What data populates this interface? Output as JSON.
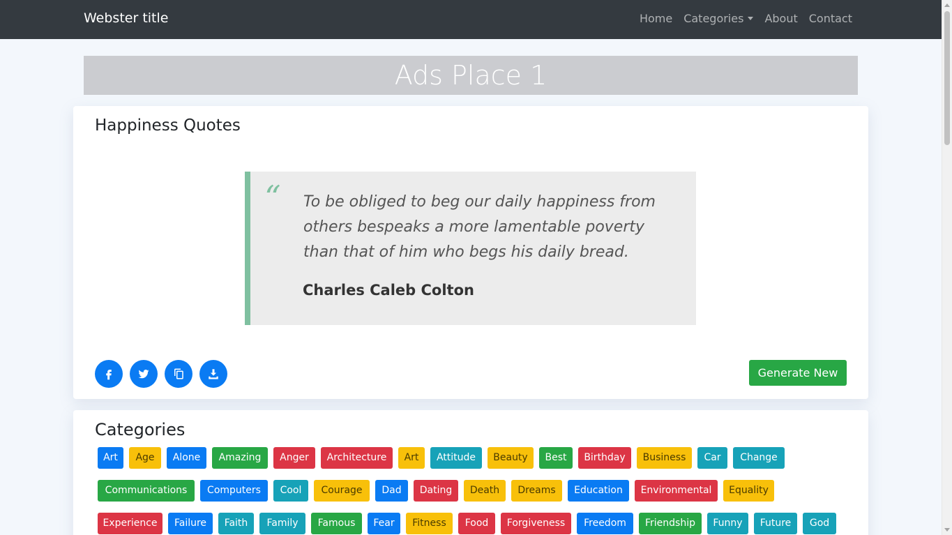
{
  "navbar": {
    "brand": "Webster title",
    "links": [
      "Home",
      "Categories",
      "About",
      "Contact"
    ]
  },
  "ads": {
    "label": "Ads Place 1"
  },
  "quote_card": {
    "title": "Happiness Quotes",
    "quote_mark": "“",
    "quote": "To be obliged to beg our daily happiness from others bespeaks a more lamentable poverty than that of him who begs his daily bread.",
    "author": "Charles Caleb Colton",
    "share_icons": [
      "facebook-icon",
      "twitter-icon",
      "copy-icon",
      "download-icon"
    ],
    "generate_label": "Generate New"
  },
  "categories": {
    "title": "Categories",
    "rows": [
      [
        {
          "label": "Art",
          "color": "primary"
        },
        {
          "label": "Age",
          "color": "warning"
        },
        {
          "label": "Alone",
          "color": "primary"
        },
        {
          "label": "Amazing",
          "color": "success"
        },
        {
          "label": "Anger",
          "color": "danger"
        },
        {
          "label": "Architecture",
          "color": "danger"
        },
        {
          "label": "Art",
          "color": "warning"
        },
        {
          "label": "Attitude",
          "color": "info"
        },
        {
          "label": "Beauty",
          "color": "warning"
        },
        {
          "label": "Best",
          "color": "success"
        },
        {
          "label": "Birthday",
          "color": "danger"
        },
        {
          "label": "Business",
          "color": "warning"
        },
        {
          "label": "Car",
          "color": "info"
        },
        {
          "label": "Change",
          "color": "info"
        }
      ],
      [
        {
          "label": "Communications",
          "color": "success"
        },
        {
          "label": "Computers",
          "color": "primary"
        },
        {
          "label": "Cool",
          "color": "info"
        },
        {
          "label": "Courage",
          "color": "warning"
        },
        {
          "label": "Dad",
          "color": "primary"
        },
        {
          "label": "Dating",
          "color": "danger"
        },
        {
          "label": "Death",
          "color": "warning"
        },
        {
          "label": "Dreams",
          "color": "warning"
        },
        {
          "label": "Education",
          "color": "primary"
        },
        {
          "label": "Environmental",
          "color": "danger"
        },
        {
          "label": "Equality",
          "color": "warning"
        }
      ],
      [
        {
          "label": "Experience",
          "color": "danger"
        },
        {
          "label": "Failure",
          "color": "primary"
        },
        {
          "label": "Faith",
          "color": "info"
        },
        {
          "label": "Family",
          "color": "info"
        },
        {
          "label": "Famous",
          "color": "success"
        },
        {
          "label": "Fear",
          "color": "primary"
        },
        {
          "label": "Fitness",
          "color": "warning"
        },
        {
          "label": "Food",
          "color": "danger"
        },
        {
          "label": "Forgiveness",
          "color": "danger"
        },
        {
          "label": "Freedom",
          "color": "primary"
        },
        {
          "label": "Friendship",
          "color": "success"
        },
        {
          "label": "Funny",
          "color": "info"
        },
        {
          "label": "Future",
          "color": "info"
        },
        {
          "label": "God",
          "color": "info"
        }
      ]
    ]
  },
  "colors": {
    "navbar": "#343a40",
    "primary": "#0a7bf3",
    "success": "#28a745",
    "warning": "#f8c00a",
    "danger": "#dc3545",
    "info": "#17a2b8",
    "quote_accent": "#7fc0a0"
  }
}
